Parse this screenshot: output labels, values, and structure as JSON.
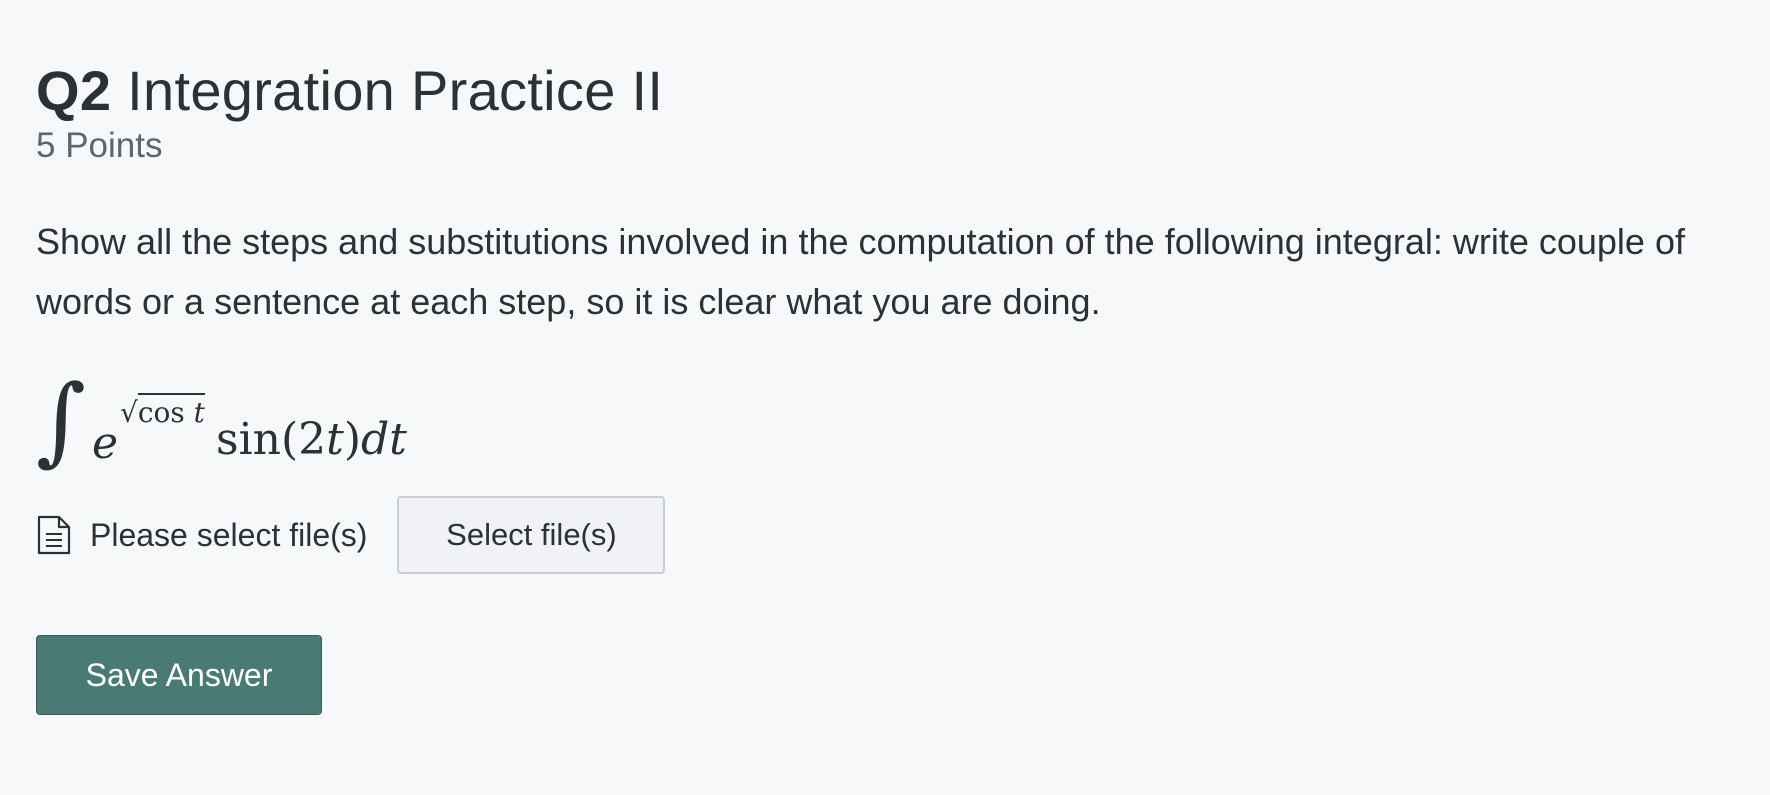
{
  "question": {
    "number": "Q2",
    "title": "Integration Practice II",
    "points": "5 Points",
    "prompt": "Show all the steps and substitutions involved in the computation of the following integral: write couple of words or a sentence at each step, so it is clear what you are doing."
  },
  "formula": {
    "integral_sign": "∫",
    "base": "e",
    "sqrt_sign": "√",
    "radicand_func": "cos",
    "radicand_var": "t",
    "func": "sin(2",
    "func_var": "t",
    "func_close": ")",
    "differential": "dt"
  },
  "upload": {
    "icon": "document-icon",
    "status": "Please select file(s)",
    "button_label": "Select file(s)"
  },
  "actions": {
    "save_label": "Save Answer",
    "save_color": "#4a7a74"
  }
}
